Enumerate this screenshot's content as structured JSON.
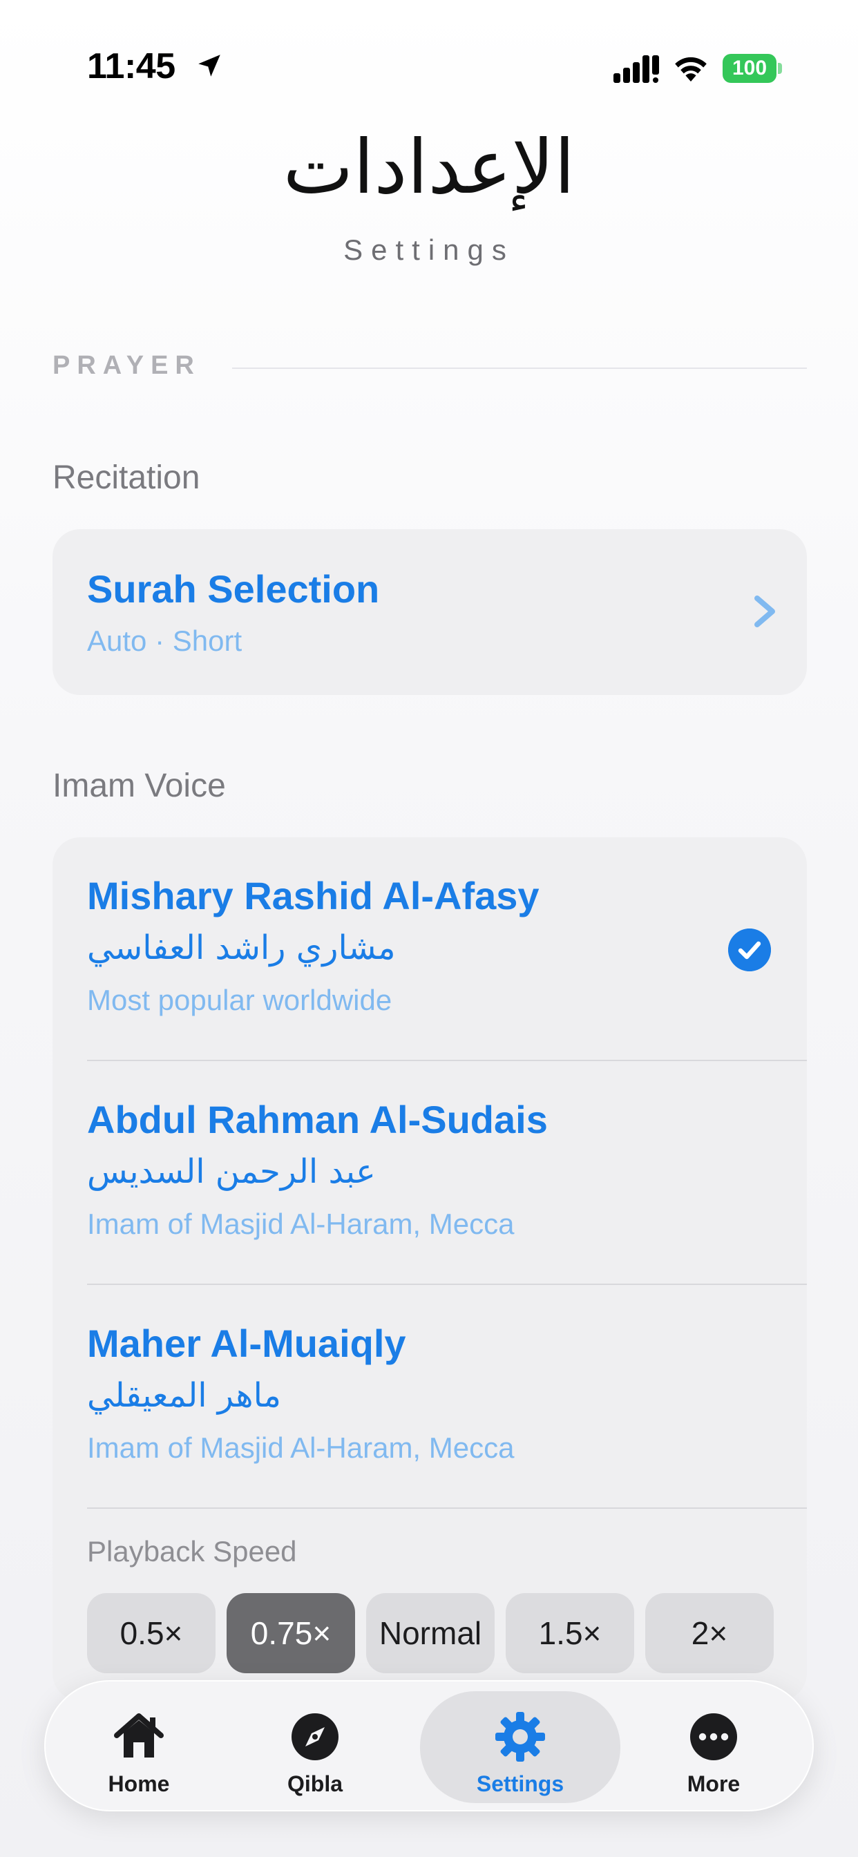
{
  "status_bar": {
    "time": "11:45",
    "battery": "100",
    "icons": [
      "location-arrow-icon",
      "signal-icon",
      "wifi-icon",
      "battery-icon"
    ]
  },
  "header": {
    "title_ar": "الإعدادات",
    "title_en": "Settings"
  },
  "section": {
    "label": "PRAYER"
  },
  "recitation": {
    "label": "Recitation",
    "surah_selection": {
      "title": "Surah Selection",
      "subtitle": "Auto · Short"
    }
  },
  "imam_voice": {
    "label": "Imam Voice",
    "voices": [
      {
        "name": "Mishary Rashid Al-Afasy",
        "name_ar": "مشاري راشد العفاسي",
        "description": "Most popular worldwide",
        "selected": true
      },
      {
        "name": "Abdul Rahman Al-Sudais",
        "name_ar": "عبد الرحمن السديس",
        "description": "Imam of Masjid Al-Haram, Mecca",
        "selected": false
      },
      {
        "name": "Maher Al-Muaiqly",
        "name_ar": "ماهر المعيقلي",
        "description": "Imam of Masjid Al-Haram, Mecca",
        "selected": false
      }
    ],
    "playback_speed": {
      "label": "Playback Speed",
      "options": [
        "0.5×",
        "0.75×",
        "Normal",
        "1.5×",
        "2×"
      ],
      "selected": "0.75×"
    }
  },
  "tabbar": {
    "tabs": [
      {
        "label": "Home",
        "icon": "home-icon"
      },
      {
        "label": "Qibla",
        "icon": "compass-icon"
      },
      {
        "label": "Settings",
        "icon": "gear-icon"
      },
      {
        "label": "More",
        "icon": "more-icon"
      }
    ],
    "active": "Settings"
  },
  "colors": {
    "accent": "#1a7de6",
    "accent_light": "#80b9f0",
    "battery": "#34c759"
  }
}
